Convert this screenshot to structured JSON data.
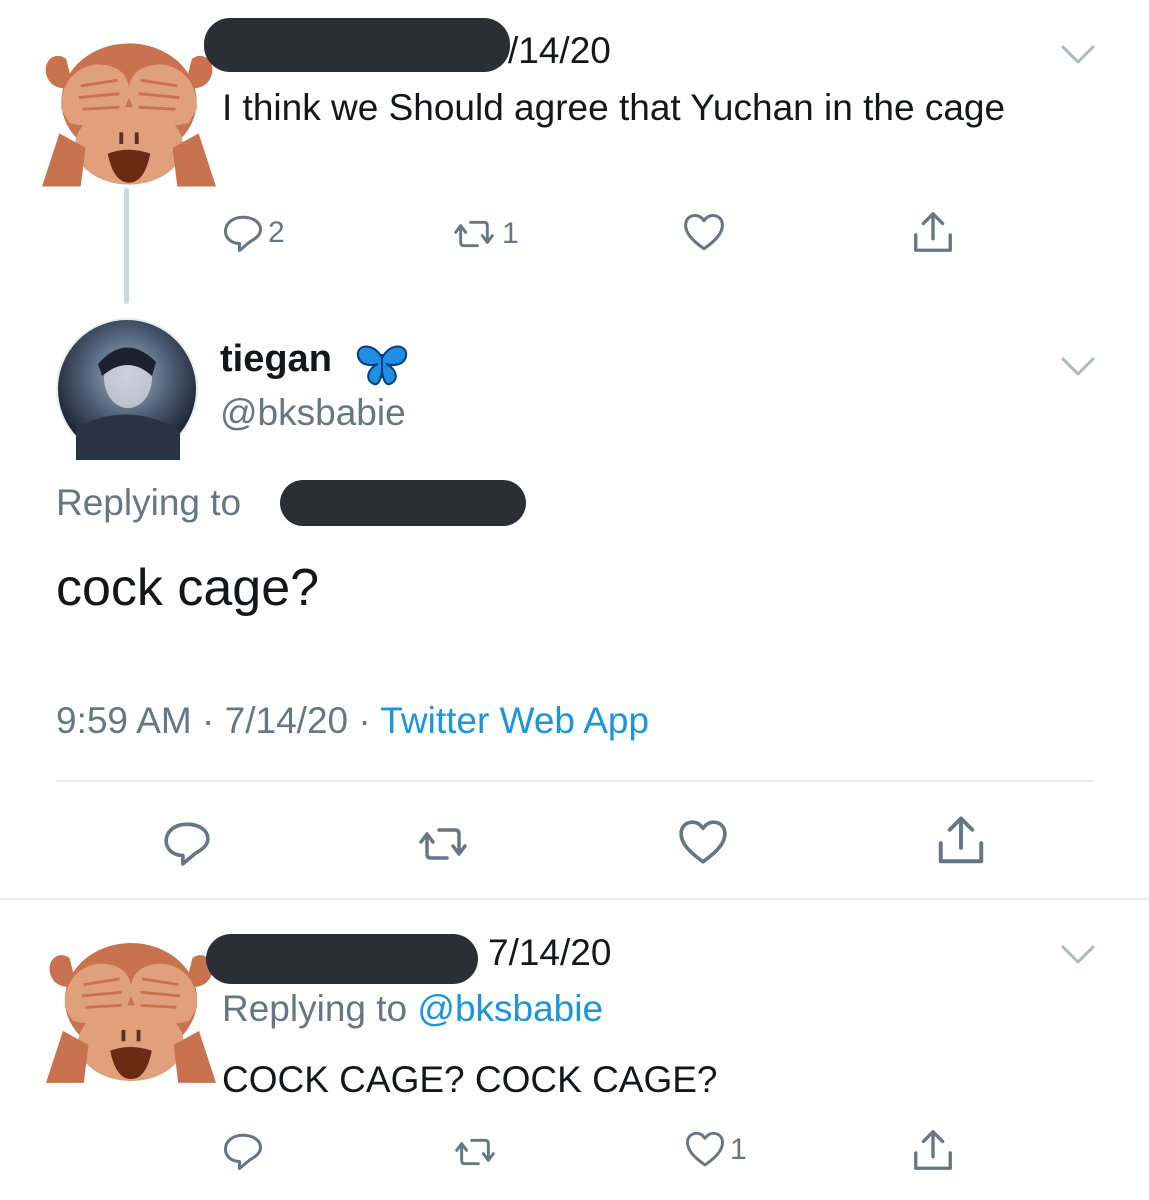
{
  "tweet1": {
    "date": "/14/20",
    "text": "I think we Should agree that Yuchan in the cage",
    "reply_count": "2",
    "retweet_count": "1",
    "avatar_icon": "see-no-evil-monkey-icon"
  },
  "main_tweet": {
    "display_name": "tiegan",
    "badge_icon": "blue-butterfly-icon",
    "handle": "@bksbabie",
    "replying_to_label": "Replying to",
    "text": "cock cage?",
    "time": "9:59 AM",
    "sep1": "·",
    "date": "7/14/20",
    "sep2": "·",
    "source": "Twitter Web App"
  },
  "tweet3": {
    "date": "7/14/20",
    "replying_to_label": "Replying to",
    "replying_to_handle": "@bksbabie",
    "text": "COCK CAGE? COCK CAGE?",
    "like_count": "1",
    "avatar_icon": "see-no-evil-monkey-icon"
  },
  "colors": {
    "text": "#14171a",
    "secondary": "#657786",
    "link": "#1b95e0",
    "divider": "#e6ecf0",
    "monkey_fur": "#c8724f",
    "monkey_face": "#e0a07b"
  }
}
